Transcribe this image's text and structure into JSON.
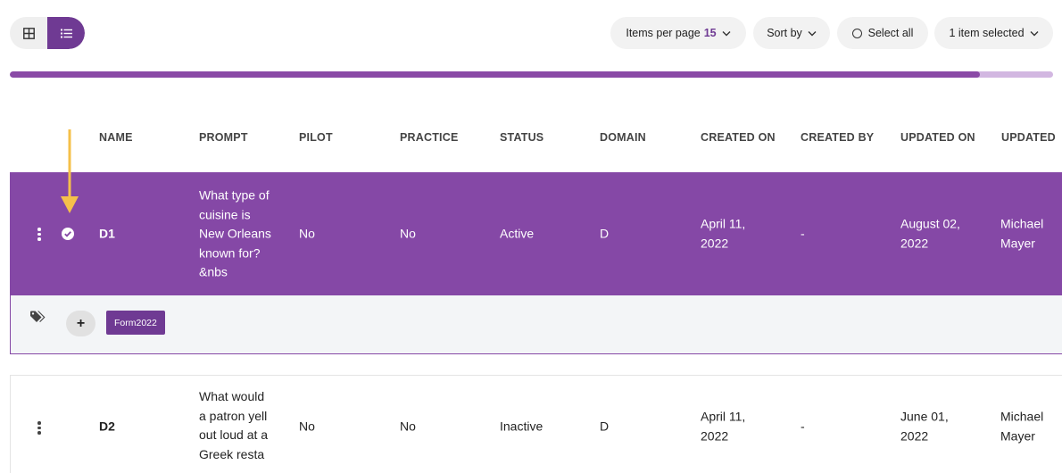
{
  "toolbar": {
    "grid_view_icon": "grid-icon",
    "list_view_icon": "list-icon",
    "items_per_page_label": "Items per page",
    "items_per_page_value": "15",
    "sort_by_label": "Sort by",
    "select_all_label": "Select all",
    "selection_label": "1 item selected"
  },
  "progress": {
    "fraction": 0.93
  },
  "table": {
    "headers": [
      "NAME",
      "PROMPT",
      "PILOT",
      "PRACTICE",
      "STATUS",
      "DOMAIN",
      "CREATED ON",
      "CREATED BY",
      "UPDATED ON",
      "UPDATED"
    ],
    "rows": [
      {
        "name": "D1",
        "prompt": [
          "What type of",
          "cuisine is",
          "New Orleans",
          "known for?",
          "&nbs"
        ],
        "pilot": "No",
        "practice": "No",
        "status": "Active",
        "domain": "D",
        "created_on": [
          "April 11,",
          "2022"
        ],
        "created_by": "-",
        "updated_on": [
          "August 02,",
          "2022"
        ],
        "updated_by": [
          "Michael",
          "Mayer"
        ],
        "selected": true,
        "tags": [
          "Form2022"
        ]
      },
      {
        "name": "D2",
        "prompt": [
          "What would",
          "a patron yell",
          "out loud at a",
          "Greek resta"
        ],
        "pilot": "No",
        "practice": "No",
        "status": "Inactive",
        "domain": "D",
        "created_on": [
          "April 11,",
          "2022"
        ],
        "created_by": "-",
        "updated_on": [
          "June 01,",
          "2022"
        ],
        "updated_by": [
          "Michael",
          "Mayer"
        ],
        "selected": false
      }
    ]
  },
  "tags_panel": {
    "tag_icon": "tags-icon",
    "add_label": "+"
  },
  "colors": {
    "accent": "#6f3a93",
    "row_selected": "#8548a6",
    "annotation_arrow": "#f5c04a"
  }
}
